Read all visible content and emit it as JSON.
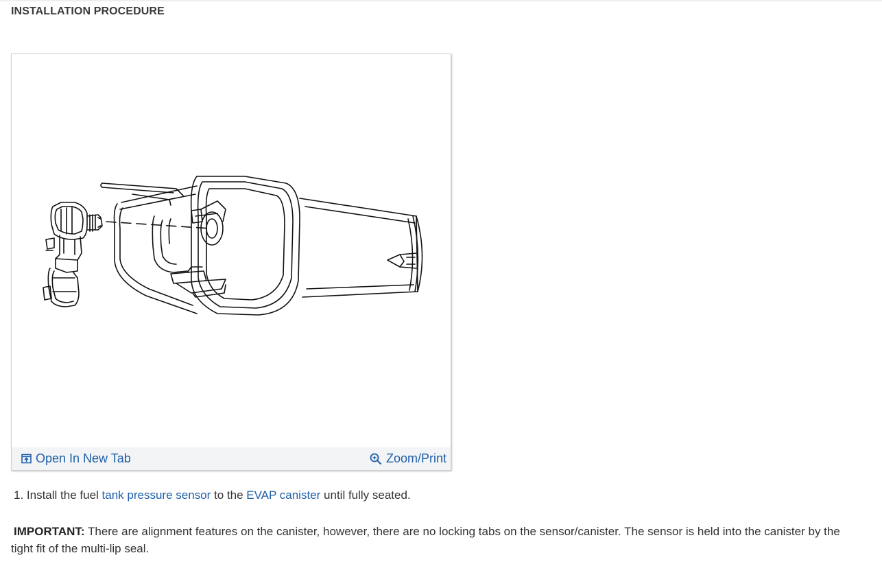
{
  "section": {
    "heading": "INSTALLATION PROCEDURE"
  },
  "figure": {
    "open_label": "Open In New Tab",
    "zoom_label": "Zoom/Print",
    "open_icon": "open-new-tab-icon",
    "zoom_icon": "zoom-icon"
  },
  "step": {
    "number": "1.",
    "text_1": " Install the fuel ",
    "link_1": "tank pressure sensor",
    "text_2": " to the ",
    "link_2": "EVAP canister",
    "text_3": " until fully seated."
  },
  "note": {
    "label": "IMPORTANT:",
    "text": " There are alignment features on the canister, however, there are no locking tabs on the sensor/canister. The sensor is held into the canister by the tight fit of the multi-lip seal."
  },
  "colors": {
    "link": "#1f5fa8",
    "text": "#333333",
    "toolbar_bg": "#f3f4f6"
  }
}
